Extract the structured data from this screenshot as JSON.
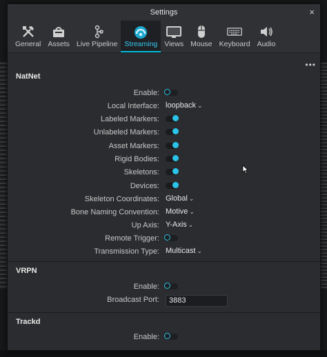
{
  "window": {
    "title": "Settings",
    "close_glyph": "×"
  },
  "tabs": [
    {
      "label": "General",
      "icon": "tools-icon"
    },
    {
      "label": "Assets",
      "icon": "basket-icon"
    },
    {
      "label": "Live Pipeline",
      "icon": "pipeline-icon"
    },
    {
      "label": "Streaming",
      "icon": "streaming-icon",
      "active": true
    },
    {
      "label": "Views",
      "icon": "monitor-icon"
    },
    {
      "label": "Mouse",
      "icon": "mouse-icon"
    },
    {
      "label": "Keyboard",
      "icon": "keyboard-icon"
    },
    {
      "label": "Audio",
      "icon": "speaker-icon"
    }
  ],
  "more_glyph": "•••",
  "natnet": {
    "title": "NatNet",
    "enable": {
      "label": "Enable:",
      "state": "off"
    },
    "local_interface": {
      "label": "Local Interface:",
      "value": "loopback"
    },
    "labeled_markers": {
      "label": "Labeled Markers:",
      "state": "on"
    },
    "unlabeled_markers": {
      "label": "Unlabeled Markers:",
      "state": "on"
    },
    "asset_markers": {
      "label": "Asset Markers:",
      "state": "on"
    },
    "rigid_bodies": {
      "label": "Rigid Bodies:",
      "state": "on"
    },
    "skeletons": {
      "label": "Skeletons:",
      "state": "on"
    },
    "devices": {
      "label": "Devices:",
      "state": "on"
    },
    "skeleton_coordinates": {
      "label": "Skeleton Coordinates:",
      "value": "Global"
    },
    "bone_naming": {
      "label": "Bone Naming Convention:",
      "value": "Motive"
    },
    "up_axis": {
      "label": "Up Axis:",
      "value": "Y-Axis"
    },
    "remote_trigger": {
      "label": "Remote Trigger:",
      "state": "off"
    },
    "transmission_type": {
      "label": "Transmission Type:",
      "value": "Multicast"
    }
  },
  "vrpn": {
    "title": "VRPN",
    "enable": {
      "label": "Enable:",
      "state": "off"
    },
    "broadcast_port": {
      "label": "Broadcast Port:",
      "value": "3883"
    }
  },
  "trackd": {
    "title": "Trackd",
    "enable": {
      "label": "Enable:",
      "state": "off"
    }
  },
  "colors": {
    "accent": "#2bc4e8",
    "panel": "#2b2c2f",
    "titlebar": "#303135"
  }
}
